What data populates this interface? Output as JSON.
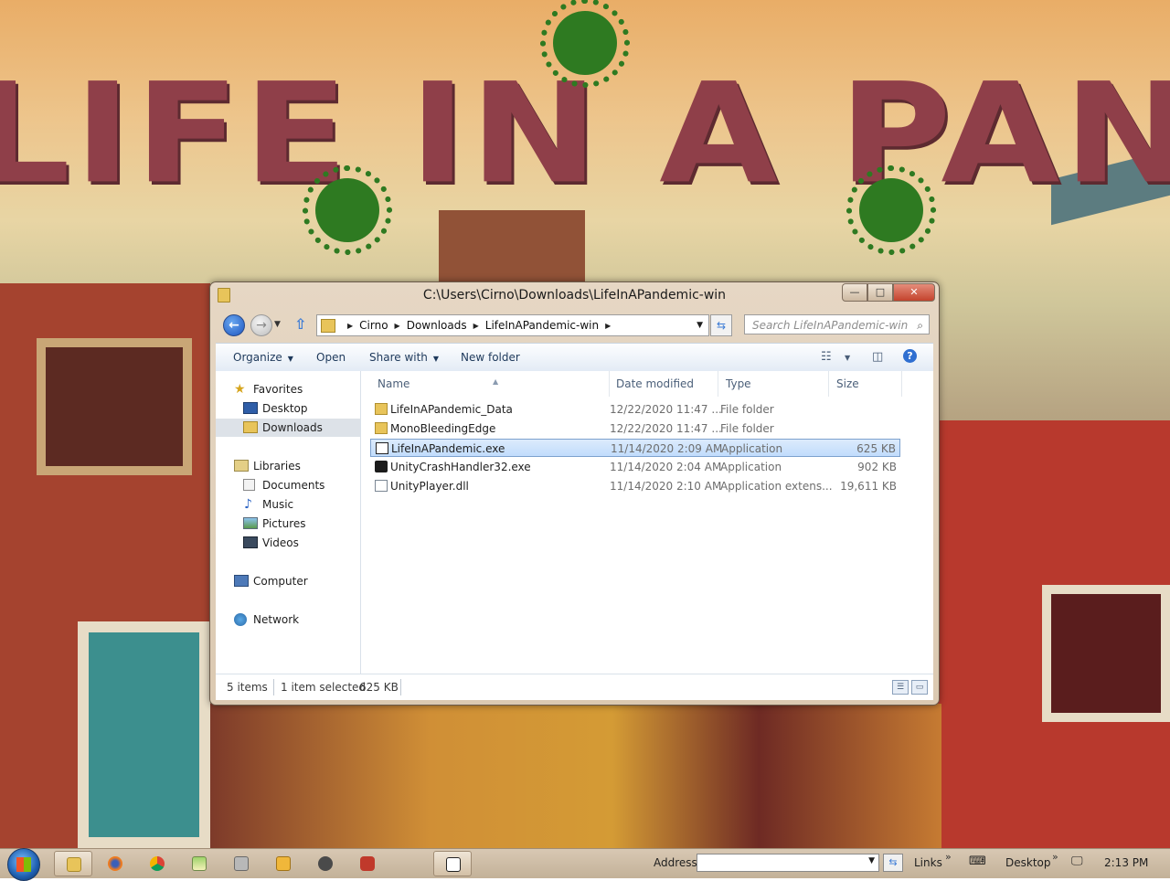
{
  "wallpaper": {
    "title_text": "LIFE IN A PANDEMIC"
  },
  "window": {
    "title": "C:\\Users\\Cirno\\Downloads\\LifeInAPandemic-win",
    "caption": {
      "minimize": "—",
      "maximize": "□",
      "close": "✕"
    }
  },
  "address": {
    "crumbs": [
      "Cirno",
      "Downloads",
      "LifeInAPandemic-win"
    ],
    "search_placeholder": "Search LifeInAPandemic-win"
  },
  "toolbar": {
    "organize": "Organize",
    "open": "Open",
    "share_with": "Share with",
    "new_folder": "New folder"
  },
  "nav": {
    "favorites": "Favorites",
    "desktop": "Desktop",
    "downloads": "Downloads",
    "libraries": "Libraries",
    "documents": "Documents",
    "music": "Music",
    "pictures": "Pictures",
    "videos": "Videos",
    "computer": "Computer",
    "network": "Network"
  },
  "columns": {
    "name": "Name",
    "date": "Date modified",
    "type": "Type",
    "size": "Size"
  },
  "files": [
    {
      "name": "LifeInAPandemic_Data",
      "date": "12/22/2020 11:47 ...",
      "type": "File folder",
      "size": "",
      "icon": "folder-icon"
    },
    {
      "name": "MonoBleedingEdge",
      "date": "12/22/2020 11:47 ...",
      "type": "File folder",
      "size": "",
      "icon": "folder-icon"
    },
    {
      "name": "LifeInAPandemic.exe",
      "date": "11/14/2020 2:09 AM",
      "type": "Application",
      "size": "625 KB",
      "icon": "unity-app-icon",
      "selected": true
    },
    {
      "name": "UnityCrashHandler32.exe",
      "date": "11/14/2020 2:04 AM",
      "type": "Application",
      "size": "902 KB",
      "icon": "unity-app-icon"
    },
    {
      "name": "UnityPlayer.dll",
      "date": "11/14/2020 2:10 AM",
      "type": "Application extens...",
      "size": "19,611 KB",
      "icon": "dll-file-icon"
    }
  ],
  "status": {
    "items": "5 items",
    "selection": "1 item selected",
    "size": "625 KB"
  },
  "taskbar": {
    "address_label": "Address",
    "links_label": "Links",
    "desktop_label": "Desktop",
    "clock": "2:13 PM",
    "chevron": "»"
  },
  "colors": {
    "selection_fill": "#c1dcfc",
    "selection_border": "#7da2ce",
    "command_text": "#1e395b",
    "wallpaper_title": "#8f3f49",
    "virus_green": "#2e7a21"
  }
}
